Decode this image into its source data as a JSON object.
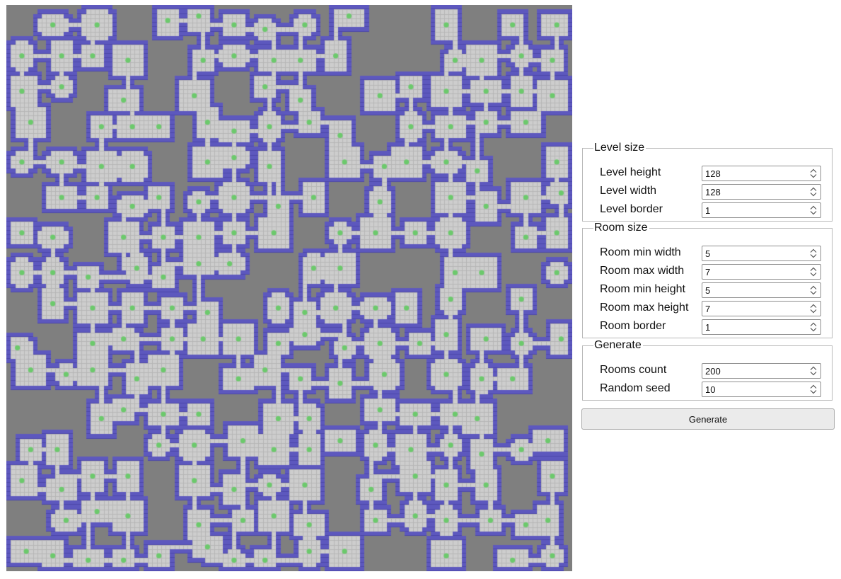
{
  "map": {
    "colors": {
      "background": "#7f7f7f",
      "wall": "#5d58be",
      "floor": "#cdcdcd",
      "grid": "#b6b6b6",
      "room_center": "#6cc96c"
    }
  },
  "panel": {
    "level_size": {
      "legend": "Level size",
      "fields": [
        {
          "label": "Level height",
          "value": "128"
        },
        {
          "label": "Level width",
          "value": "128"
        },
        {
          "label": "Level border",
          "value": "1"
        }
      ]
    },
    "room_size": {
      "legend": "Room size",
      "fields": [
        {
          "label": "Room min width",
          "value": "5"
        },
        {
          "label": "Room max width",
          "value": "7"
        },
        {
          "label": "Room min height",
          "value": "5"
        },
        {
          "label": "Room max height",
          "value": "7"
        },
        {
          "label": "Room border",
          "value": "1"
        }
      ]
    },
    "generate": {
      "legend": "Generate",
      "fields": [
        {
          "label": "Rooms count",
          "value": "200"
        },
        {
          "label": "Random seed",
          "value": "10"
        }
      ]
    },
    "generate_button_label": "Generate"
  }
}
